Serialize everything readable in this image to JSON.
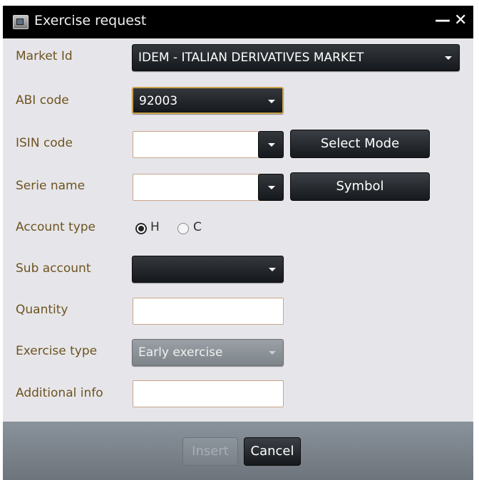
{
  "window": {
    "title": "Exercise request",
    "minimize_glyph": "—",
    "close_glyph": "✕"
  },
  "form": {
    "market_id": {
      "label": "Market Id",
      "value": "IDEM - ITALIAN DERIVATIVES MARKET"
    },
    "abi_code": {
      "label": "ABI code",
      "value": "92003"
    },
    "isin_code": {
      "label": "ISIN code",
      "value": "",
      "button_label": "Select Mode"
    },
    "serie_name": {
      "label": "Serie name",
      "value": "",
      "button_label": "Symbol"
    },
    "account_type": {
      "label": "Account type",
      "options": [
        {
          "label": "H",
          "checked": true
        },
        {
          "label": "C",
          "checked": false
        }
      ]
    },
    "sub_account": {
      "label": "Sub account",
      "value": ""
    },
    "quantity": {
      "label": "Quantity",
      "value": ""
    },
    "exercise_type": {
      "label": "Exercise type",
      "value": "Early exercise",
      "disabled": true
    },
    "additional_info": {
      "label": "Additional info",
      "value": ""
    }
  },
  "footer": {
    "insert_label": "Insert",
    "insert_disabled": true,
    "cancel_label": "Cancel"
  },
  "icons": {
    "app": "window-app-icon",
    "dropdown": "chevron-down-icon"
  },
  "colors": {
    "label_text": "#6e5320",
    "focus_border": "#c9a24a",
    "titlebar": "#000000",
    "content_bg": "#e6e6ea"
  }
}
